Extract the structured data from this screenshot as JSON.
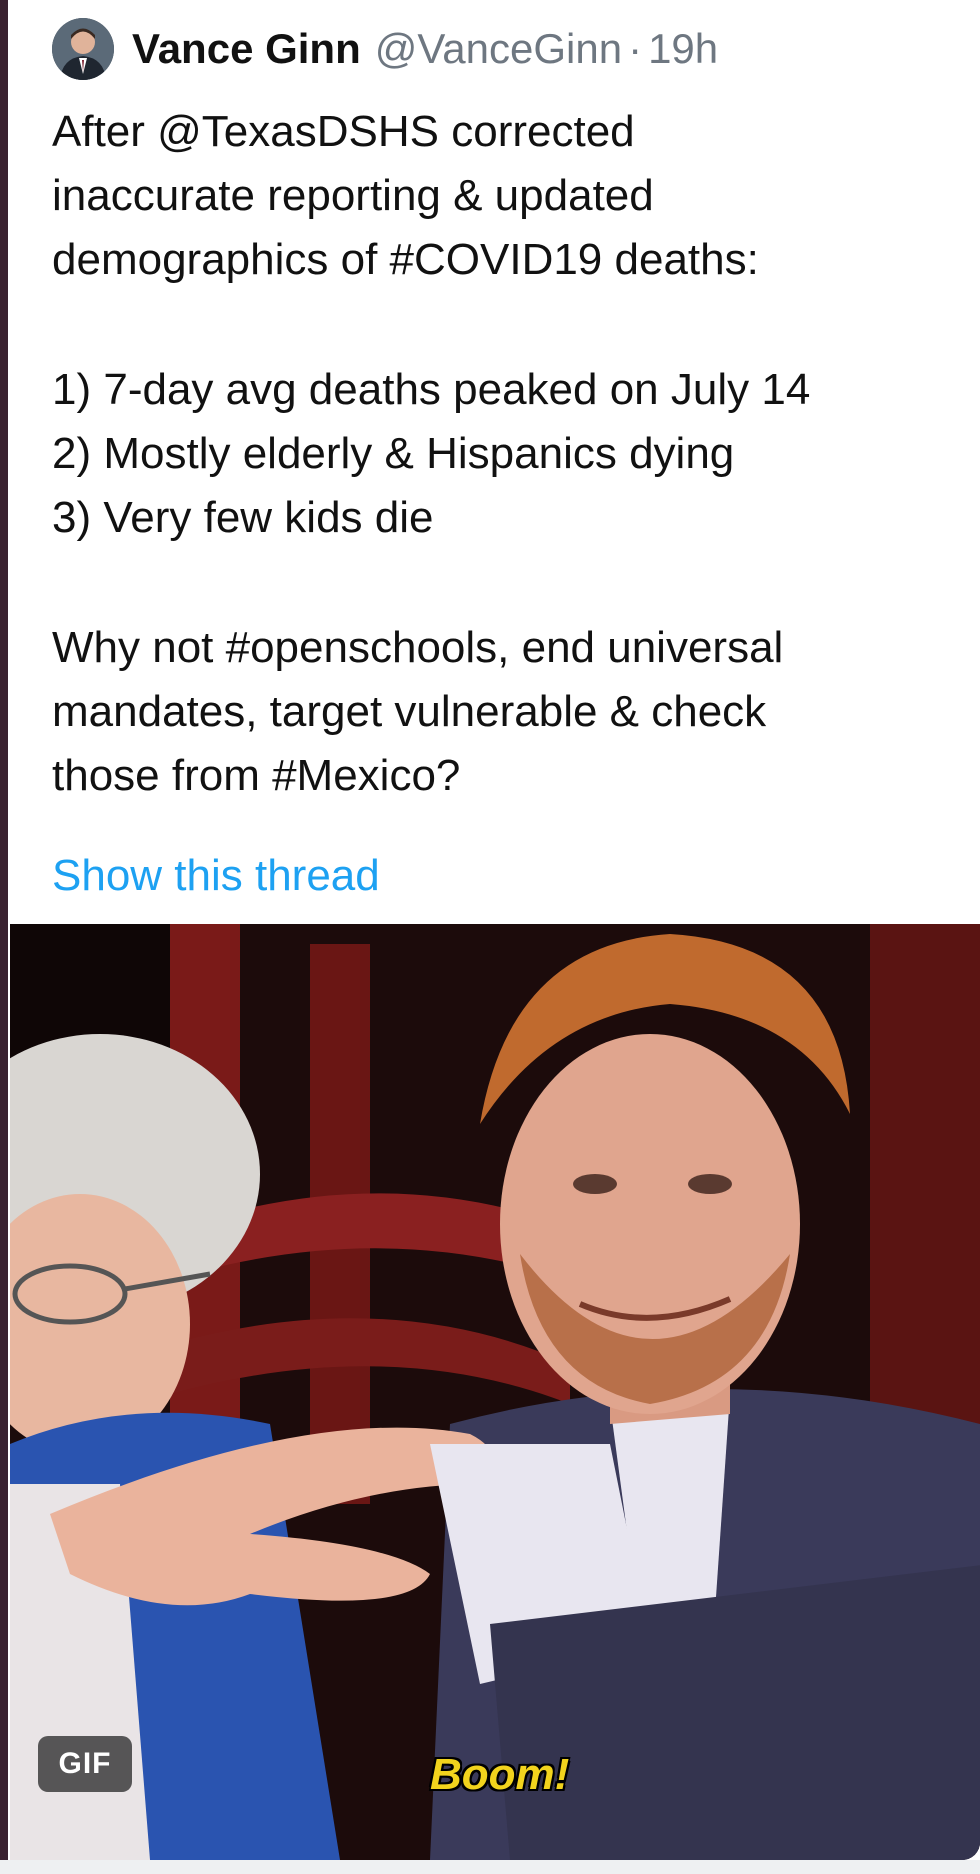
{
  "tweet": {
    "author_name": "Vance Ginn",
    "author_handle": "@VanceGinn",
    "separator": "·",
    "time_ago": "19h",
    "text_lines": [
      "After @TexasDSHS corrected",
      "inaccurate reporting & updated",
      "demographics of #COVID19 deaths:",
      "1) 7-day avg deaths peaked on July 14",
      "2) Mostly elderly & Hispanics dying",
      "3) Very few kids die",
      "Why not #openschools, end universal",
      "mandates, target vulnerable & check",
      "those from #Mexico?"
    ],
    "show_thread_label": "Show this thread"
  },
  "media": {
    "type_badge": "GIF",
    "caption": "Boom!"
  },
  "colors": {
    "link": "#1da1f2",
    "handle_gray": "#6e7781",
    "caption_yellow": "#f2d31d"
  }
}
